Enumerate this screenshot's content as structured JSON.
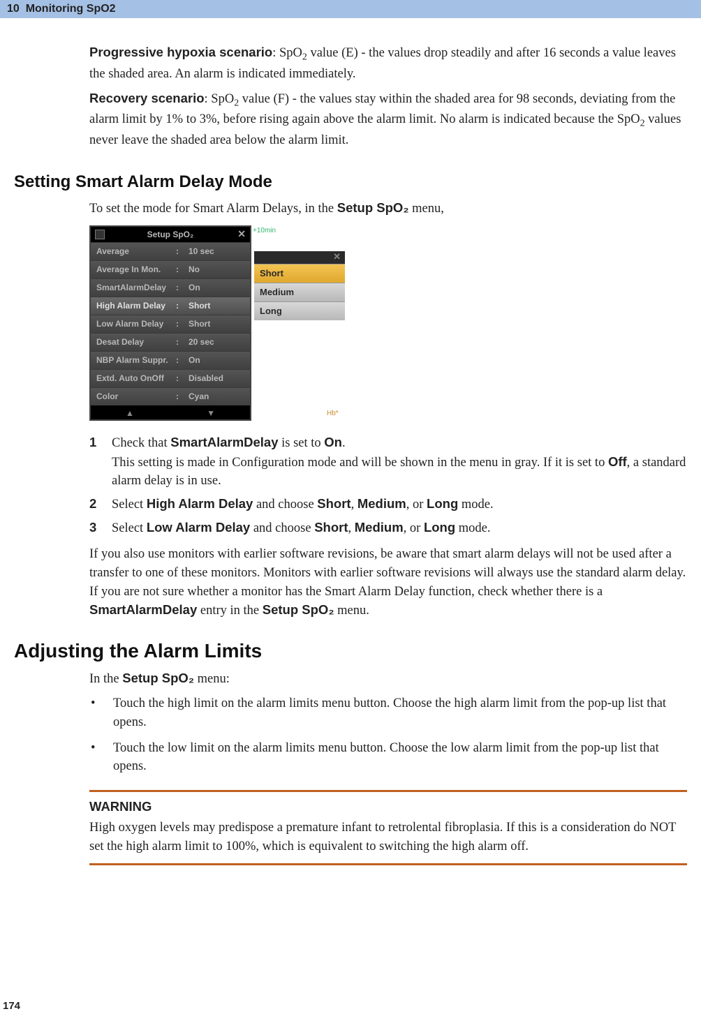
{
  "header": {
    "chapter_num": "10",
    "chapter_title": "Monitoring SpO2"
  },
  "intro": {
    "p1_bold": "Progressive hypoxia scenario",
    "p1_rest_a": ": SpO",
    "p1_rest_b": " value (E) - the values drop steadily and after 16 seconds a value leaves the shaded area. An alarm is indicated immediately.",
    "p2_bold": "Recovery scenario",
    "p2_rest_a": ": SpO",
    "p2_rest_b": " value (F) - the values stay within the shaded area for 98 seconds, deviating from the alarm limit by 1% to 3%, before rising again above the alarm limit. No alarm is indicated because the SpO",
    "p2_rest_c": " values never leave the shaded area below the alarm limit."
  },
  "section1": {
    "heading": "Setting Smart Alarm Delay Mode",
    "lead_a": "To set the mode for Smart Alarm Delays, in the ",
    "lead_b_bold": "Setup SpO₂",
    "lead_c": " menu,"
  },
  "screenshot": {
    "menu_title": "Setup SpO₂",
    "rows": [
      {
        "label": "Average",
        "value": "10 sec"
      },
      {
        "label": "Average In Mon.",
        "value": "No"
      },
      {
        "label": "SmartAlarmDelay",
        "value": "On"
      },
      {
        "label": "High Alarm Delay",
        "value": "Short"
      },
      {
        "label": "Low Alarm Delay",
        "value": "Short"
      },
      {
        "label": "Desat Delay",
        "value": "20 sec"
      },
      {
        "label": "NBP Alarm Suppr.",
        "value": "On"
      },
      {
        "label": "Extd. Auto OnOff",
        "value": "Disabled"
      },
      {
        "label": "Color",
        "value": "Cyan"
      }
    ],
    "dropdown": [
      "Short",
      "Medium",
      "Long"
    ],
    "badge_top": "+10min",
    "badge_bot": "Hb*"
  },
  "steps": {
    "s1_a": "Check that ",
    "s1_b_bold": "SmartAlarmDelay",
    "s1_c": " is set to ",
    "s1_d_bold": "On",
    "s1_e": ".",
    "s1_note_a": "This setting is made in Configuration mode and will be shown in the menu in gray. If it is set to ",
    "s1_note_b_bold": "Off",
    "s1_note_c": ", a standard alarm delay is in use.",
    "s2_a": "Select ",
    "s2_b_bold": "High Alarm Delay",
    "s2_c": " and choose ",
    "s2_d_bold": "Short",
    "s2_e": ", ",
    "s2_f_bold": "Medium",
    "s2_g": ", or ",
    "s2_h_bold": "Long",
    "s2_i": " mode.",
    "s3_a": "Select ",
    "s3_b_bold": "Low Alarm Delay",
    "s3_c": " and choose ",
    "s3_d_bold": "Short",
    "s3_e": ", ",
    "s3_f_bold": "Medium",
    "s3_g": ", or ",
    "s3_h_bold": "Long",
    "s3_i": " mode."
  },
  "after_steps": {
    "a": "If you also use monitors with earlier software revisions, be aware that smart alarm delays will not be used after a transfer to one of these monitors. Monitors with earlier software revisions will always use the standard alarm delay. If you are not sure whether a monitor has the Smart Alarm Delay function, check whether there is a ",
    "b_bold": "SmartAlarmDelay",
    "c": " entry in the ",
    "d_bold": "Setup SpO₂",
    "e": " menu."
  },
  "section2": {
    "heading": "Adjusting the Alarm Limits",
    "lead_a": "In the ",
    "lead_b_bold": "Setup SpO₂",
    "lead_c": " menu:",
    "b1": "Touch the high limit on the alarm limits menu button. Choose the high alarm limit from the pop-up list that opens.",
    "b2": "Touch the low limit on the alarm limits menu button. Choose the low alarm limit from the pop-up list that opens."
  },
  "warning": {
    "title": "WARNING",
    "text": "High oxygen levels may predispose a premature infant to retrolental fibroplasia. If this is a consideration do NOT set the high alarm limit to 100%, which is equivalent to switching the high alarm off."
  },
  "page_number": "174"
}
